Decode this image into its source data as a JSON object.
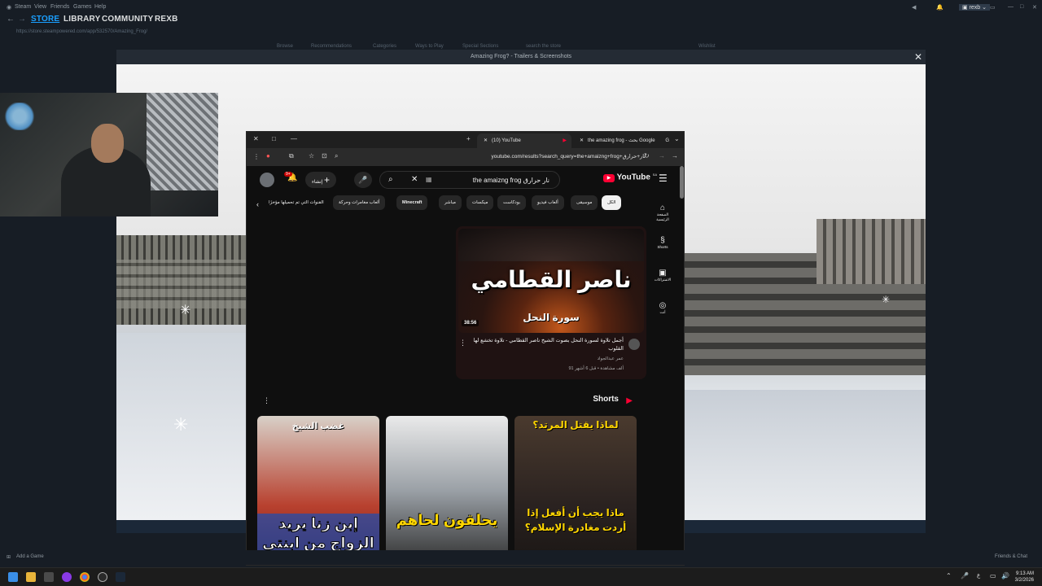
{
  "steam": {
    "app_label": "Steam",
    "menu": [
      "Steam",
      "View",
      "Friends",
      "Games",
      "Help"
    ],
    "nav": [
      "STORE",
      "LIBRARY",
      "COMMUNITY",
      "REXB"
    ],
    "url": "https://store.steampowered.com/app/532570/Amazing_Frog/",
    "user": "rexb",
    "subnav": [
      "Browse",
      "Recommendations",
      "Categories",
      "Ways to Play",
      "Special Sections"
    ],
    "search_placeholder": "search the store",
    "wishlist": "Wishlist",
    "footer_left": "Add a Game",
    "footer_right": "Friends & Chat"
  },
  "trailer": {
    "title": "Amazing Frog? - Trailers & Screenshots",
    "close": "✕"
  },
  "browser": {
    "tabs": [
      {
        "title": "(10) YouTube"
      },
      {
        "title": "the amazing frog - بحث Google"
      }
    ],
    "url": "youtube.com/results?search_query=the+amaizng+frog+نار+حرارق",
    "accent": "#ff0033"
  },
  "youtube": {
    "logo": "YouTube",
    "region": "SA",
    "search_value": "the amaizng frog نار حرارق",
    "create_label": "إنشاء",
    "notifications": "9+",
    "chips": [
      "الكل",
      "موسيقى",
      "ألعاب فيديو",
      "بودكاست",
      "ميكسات",
      "مباشر",
      "Minecraft",
      "ألعاب مغامرات وحركة",
      "القنوات التي تم تحميلها مؤخرًا"
    ],
    "sidebar": [
      "الصفحة الرئيسية",
      "Shorts",
      "الاشتراكات",
      "أنت"
    ],
    "video": {
      "thumb_title": "ناصر القطامي",
      "thumb_subtitle": "سورة النحل",
      "duration": "38:56",
      "title": "أجمل تلاوة لسورة النحل بصوت الشيخ ناصر القطامي - تلاوة تخشع لها القلوب",
      "channel": "عمر عبدالجواد",
      "meta": "91 ألف مشاهدة • قبل 6 أشهر"
    },
    "shorts_label": "Shorts",
    "shorts": [
      {
        "top": "غضب الشيخ",
        "bottom": "إبن زنا يريد الزواج من ابنتي"
      },
      {
        "top": "",
        "bottom": "يحلقون لحاهم"
      },
      {
        "top": "لماذا يقتل المرتد؟",
        "bottom": "ماذا يجب أن أفعل إذا أردت مغادرة الإسلام؟"
      }
    ]
  },
  "taskbar": {
    "time": "9:13 AM",
    "date": "3/2/2026"
  }
}
